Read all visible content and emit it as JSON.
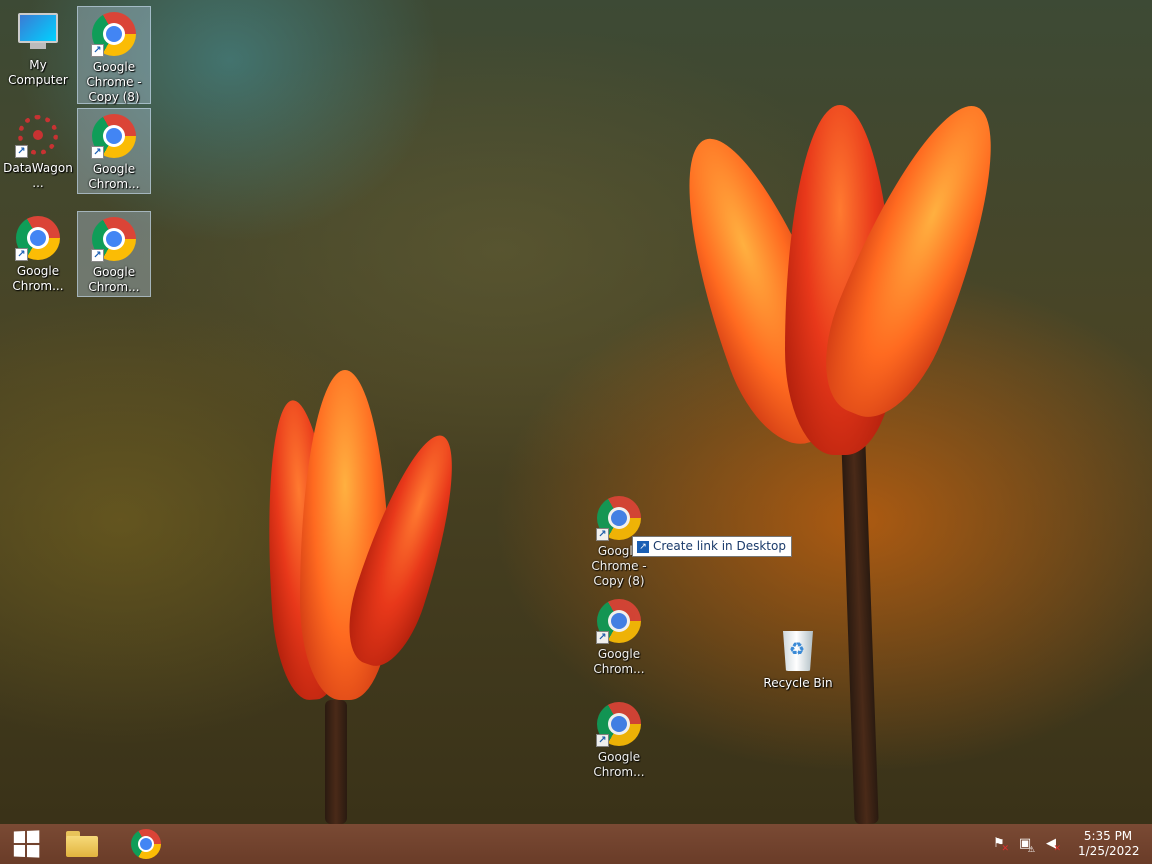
{
  "desktop": {
    "icons": [
      {
        "label": "My Computer"
      },
      {
        "label": "Google Chrome - Copy (8)"
      },
      {
        "label": "DataWagon..."
      },
      {
        "label": "Google Chrom..."
      },
      {
        "label": "Google Chrom..."
      },
      {
        "label": "Google Chrom..."
      },
      {
        "label": "Google Chrome - Copy (8)"
      },
      {
        "label": "Google Chrom..."
      },
      {
        "label": "Google Chrom..."
      },
      {
        "label": "Recycle Bin"
      }
    ],
    "tooltip": "Create link in Desktop"
  },
  "taskbar": {
    "start_icon": "windows-logo-icon",
    "pinned": [
      {
        "icon": "file-explorer-icon"
      },
      {
        "icon": "chrome-icon"
      }
    ],
    "tray": {
      "icons": [
        "action-center-flag-icon",
        "network-icon",
        "volume-muted-icon"
      ],
      "time": "5:35 PM",
      "date": "1/25/2022"
    }
  }
}
